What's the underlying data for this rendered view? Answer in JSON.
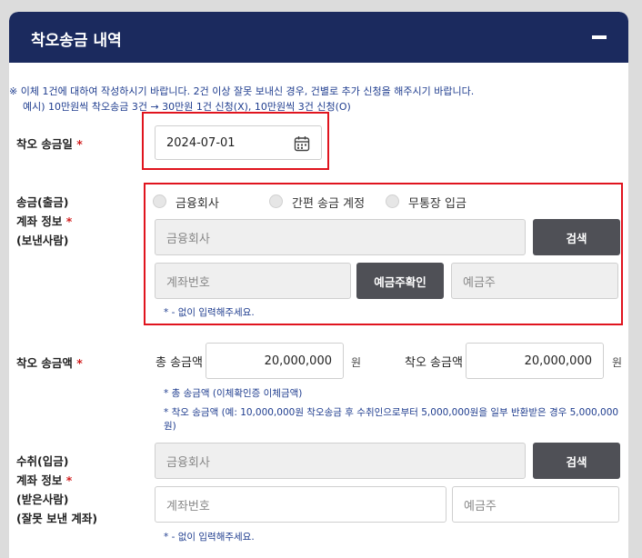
{
  "header": {
    "title": "착오송금 내역"
  },
  "notice": {
    "line1": "※ 이체 1건에 대하여 작성하시기 바랍니다. 2건 이상 잘못 보내신 경우, 건별로 추가 신청을 해주시기 바랍니다.",
    "line2": "예시) 10만원씩 착오송금 3건 → 30만원 1건 신청(X), 10만원씩 3건 신청(O)"
  },
  "date_section": {
    "label": "착오 송금일",
    "value": "2024-07-01"
  },
  "sender_section": {
    "label_lines": [
      "송금(출금)",
      "계좌 정보",
      "(보낸사람)"
    ],
    "radios": [
      "금융회사",
      "간편 송금 계정",
      "무통장 입금"
    ],
    "institution_placeholder": "금융회사",
    "search_label": "검색",
    "account_placeholder": "계좌번호",
    "verify_label": "예금주확인",
    "holder_placeholder": "예금주",
    "hint": "* - 없이 입력해주세요."
  },
  "amount_section": {
    "label": "착오 송금액",
    "total_label": "총 송금액",
    "total_value": "20,000,000",
    "unit": "원",
    "mistaken_label": "착오 송금액",
    "mistaken_value": "20,000,000",
    "hint1": "* 총 송금액 (이체확인증 이체금액)",
    "hint2": "* 착오 송금액 (예: 10,000,000원 착오송금 후 수취인으로부터 5,000,000원을 일부 반환받은 경우 5,000,000원)"
  },
  "receiver_section": {
    "label_lines": [
      "수취(입금)",
      "계좌 정보",
      "(받은사람)",
      "(잘못 보낸 계좌)"
    ],
    "institution_placeholder": "금융회사",
    "search_label": "검색",
    "account_placeholder": "계좌번호",
    "holder_placeholder": "예금주",
    "hint": "* - 없이 입력해주세요."
  },
  "colors": {
    "header": "#1b2a5e",
    "required": "#d21f1f",
    "highlight": "#e0141e",
    "button": "#4f5056"
  }
}
